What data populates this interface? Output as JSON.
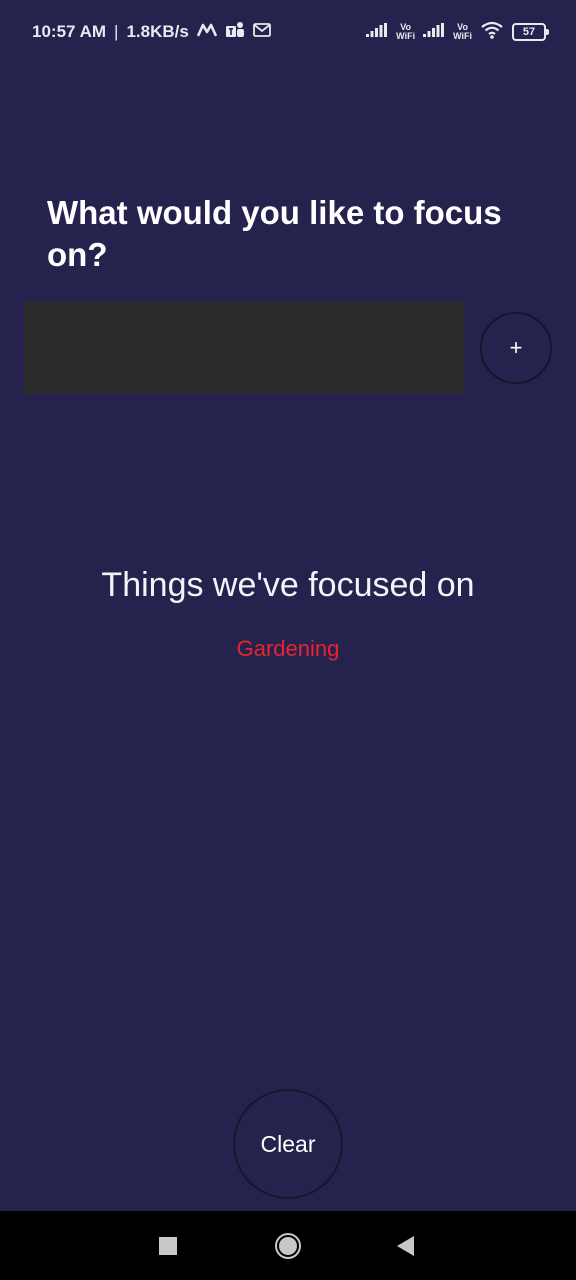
{
  "status_bar": {
    "time": "10:57 AM",
    "separator": "|",
    "network_speed": "1.8KB/s",
    "battery_level": "57",
    "vowifi_top": "Vo",
    "vowifi_bottom": "WiFi",
    "icons": [
      "signal-icon",
      "vowifi-icon",
      "signal-icon",
      "vowifi-icon",
      "wifi-icon",
      "battery-icon",
      "m-app-icon",
      "teams-icon",
      "gmail-icon"
    ]
  },
  "main": {
    "heading": "What would you like to focus on?",
    "input_value": "",
    "add_button_label": "+",
    "history_title": "Things we've focused on",
    "history_items": [
      "Gardening"
    ],
    "clear_button_label": "Clear"
  },
  "colors": {
    "background": "#25224e",
    "input_background": "#2b2b2b",
    "history_item": "#e8242f",
    "nav_bar": "#000000"
  },
  "nav_bar": {
    "icons": [
      "recents-square-icon",
      "home-circle-icon",
      "back-triangle-icon"
    ]
  }
}
